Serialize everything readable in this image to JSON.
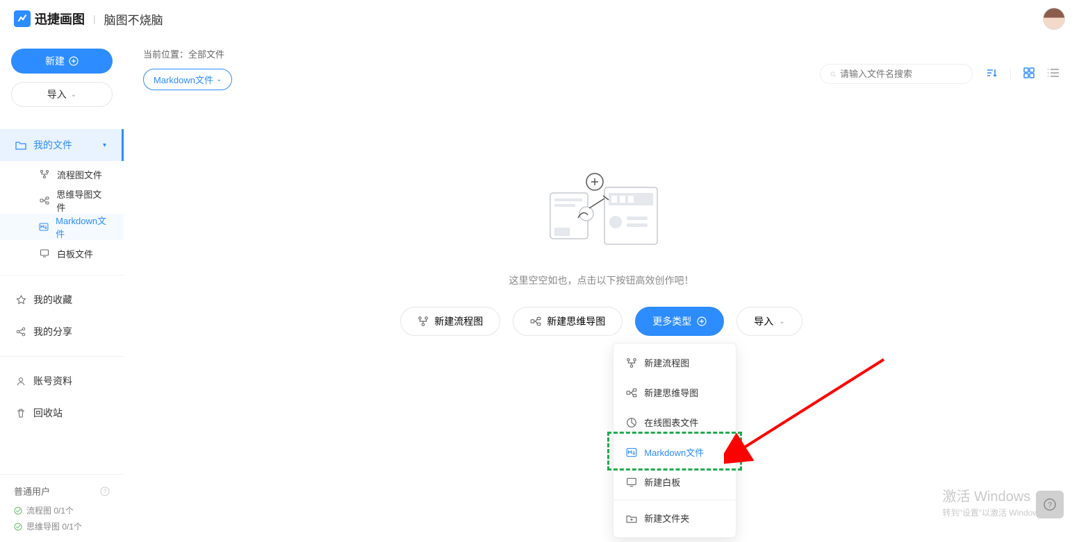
{
  "header": {
    "brand": "迅捷画图",
    "tagline": "脑图不烧脑"
  },
  "sidebar": {
    "new_btn": "新建",
    "import_btn": "导入",
    "items": [
      {
        "label": "我的文件",
        "icon": "folder"
      },
      {
        "label": "流程图文件",
        "icon": "flow"
      },
      {
        "label": "思维导图文件",
        "icon": "mind"
      },
      {
        "label": "Markdown文件",
        "icon": "md"
      },
      {
        "label": "白板文件",
        "icon": "board"
      }
    ],
    "extras": [
      {
        "label": "我的收藏",
        "icon": "star"
      },
      {
        "label": "我的分享",
        "icon": "share"
      },
      {
        "label": "账号资料",
        "icon": "user"
      },
      {
        "label": "回收站",
        "icon": "trash"
      }
    ],
    "user_label": "普通用户",
    "quota_flow": "流程图 0/1个",
    "quota_mind": "思维导图 0/1个"
  },
  "main": {
    "breadcrumb_label": "当前位置：",
    "breadcrumb_value": "全部文件",
    "filter": "Markdown文件",
    "search_placeholder": "请输入文件名搜索",
    "empty_text": "这里空空如也，点击以下按钮高效创作吧！",
    "actions": {
      "flow": "新建流程图",
      "mind": "新建思维导图",
      "more": "更多类型",
      "import": "导入"
    },
    "dropdown": [
      {
        "label": "新建流程图",
        "icon": "flow"
      },
      {
        "label": "新建思维导图",
        "icon": "mind"
      },
      {
        "label": "在线图表文件",
        "icon": "chart"
      },
      {
        "label": "Markdown文件",
        "icon": "md",
        "hl": true
      },
      {
        "label": "新建白板",
        "icon": "board"
      },
      {
        "label": "新建文件夹",
        "icon": "folder-plus",
        "sep": true
      }
    ]
  },
  "watermark": {
    "line1": "激活 Windows",
    "line2": "转到\"设置\"以激活 Windows。"
  },
  "help_badge": "帮助反馈"
}
